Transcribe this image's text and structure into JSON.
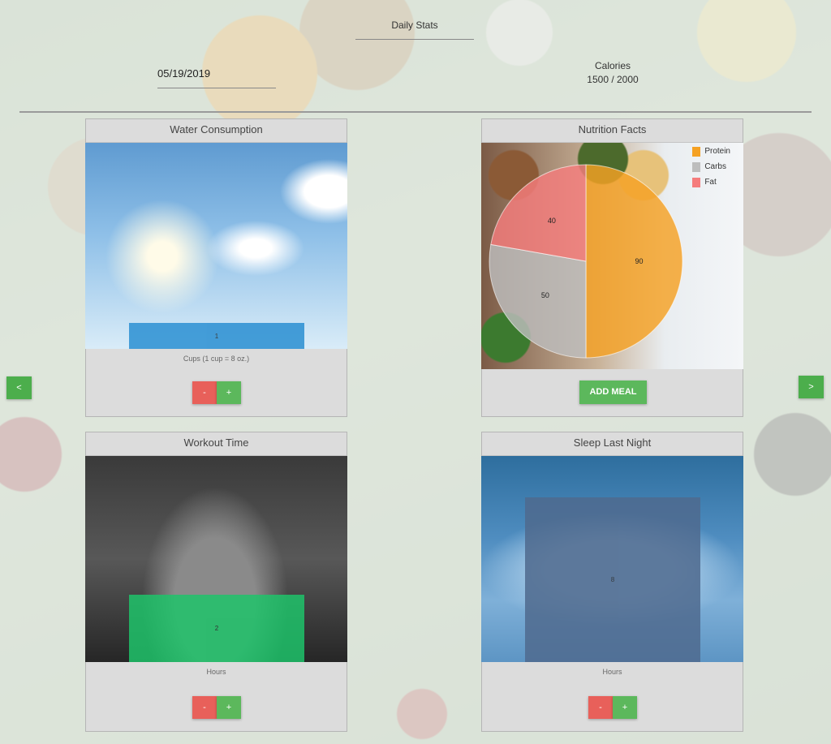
{
  "header": {
    "title": "Daily Stats",
    "date": "05/19/2019",
    "calories_label": "Calories",
    "calories_value": "1500 / 2000"
  },
  "nav": {
    "prev_label": "<",
    "next_label": ">"
  },
  "water": {
    "title": "Water Consumption",
    "value": "1",
    "caption": "Cups (1 cup = 8 oz.)",
    "minus_label": "-",
    "plus_label": "+",
    "bar_color": "#2a8fd2"
  },
  "nutrition": {
    "title": "Nutrition Facts",
    "add_meal_label": "ADD MEAL",
    "colors": {
      "protein": "#f5a123",
      "carbs": "#bdbdbd",
      "fat": "#f57c7c"
    },
    "chart_data": {
      "type": "pie",
      "categories": [
        "Protein",
        "Carbs",
        "Fat"
      ],
      "values": [
        90,
        50,
        40
      ],
      "legend": "top-right"
    }
  },
  "workout": {
    "title": "Workout Time",
    "value": "2",
    "caption": "Hours",
    "minus_label": "-",
    "plus_label": "+",
    "bar_color": "#1ec36a"
  },
  "sleep": {
    "title": "Sleep Last Night",
    "value": "8",
    "caption": "Hours",
    "minus_label": "-",
    "plus_label": "+",
    "bar_color": "#4f6a8e"
  }
}
